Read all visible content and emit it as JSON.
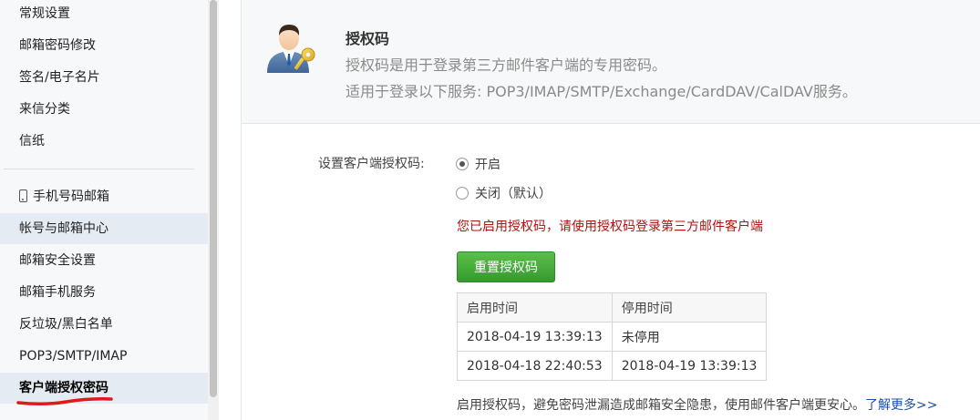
{
  "sidebar": {
    "items": [
      {
        "label": "常规设置"
      },
      {
        "label": "邮箱密码修改"
      },
      {
        "label": "签名/电子名片"
      },
      {
        "label": "来信分类"
      },
      {
        "label": "信纸"
      },
      {
        "label": "手机号码邮箱"
      },
      {
        "label": "帐号与邮箱中心"
      },
      {
        "label": "邮箱安全设置"
      },
      {
        "label": "邮箱手机服务"
      },
      {
        "label": "反垃圾/黑白名单"
      },
      {
        "label": "POP3/SMTP/IMAP"
      },
      {
        "label": "客户端授权密码"
      }
    ]
  },
  "header": {
    "title": "授权码",
    "desc1": "授权码是用于登录第三方邮件客户端的专用密码。",
    "desc2": "适用于登录以下服务: POP3/IMAP/SMTP/Exchange/CardDAV/CalDAV服务。"
  },
  "settings": {
    "label": "设置客户端授权码:",
    "option_on": "开启",
    "option_off": "关闭（默认）",
    "selected": "开启",
    "status_message": "您已启用授权码，请使用授权码登录第三方邮件客户端",
    "reset_button": "重置授权码"
  },
  "table": {
    "headers": [
      "启用时间",
      "停用时间"
    ],
    "rows": [
      [
        "2018-04-19 13:39:13",
        "未停用"
      ],
      [
        "2018-04-18 22:40:53",
        "2018-04-19 13:39:13"
      ]
    ]
  },
  "footer": {
    "note": "启用授权码，避免密码泄漏造成邮箱安全隐患，使用邮件客户端更安心。",
    "learn_more": "了解更多>>"
  },
  "colors": {
    "accent_green": "#3ea83e",
    "warning_red": "#b1120f",
    "link_blue": "#1d4fa8",
    "annotation_red": "#e0191a"
  }
}
